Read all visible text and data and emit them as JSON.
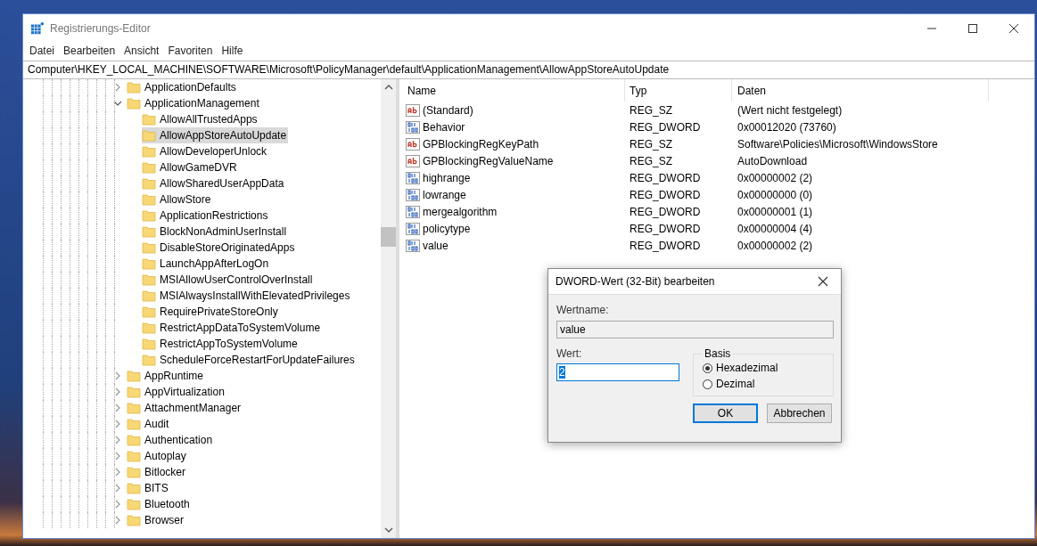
{
  "window": {
    "title": "Registrierungs-Editor"
  },
  "menu": [
    "Datei",
    "Bearbeiten",
    "Ansicht",
    "Favoriten",
    "Hilfe"
  ],
  "address": "Computer\\HKEY_LOCAL_MACHINE\\SOFTWARE\\Microsoft\\PolicyManager\\default\\ApplicationManagement\\AllowAppStoreAutoUpdate",
  "tree": {
    "items": [
      {
        "label": "ApplicationDefaults",
        "expanded": false,
        "selected": false
      },
      {
        "label": "ApplicationManagement",
        "expanded": true,
        "selected": false,
        "children": [
          {
            "label": "AllowAllTrustedApps",
            "selected": false
          },
          {
            "label": "AllowAppStoreAutoUpdate",
            "selected": true
          },
          {
            "label": "AllowDeveloperUnlock",
            "selected": false
          },
          {
            "label": "AllowGameDVR",
            "selected": false
          },
          {
            "label": "AllowSharedUserAppData",
            "selected": false
          },
          {
            "label": "AllowStore",
            "selected": false
          },
          {
            "label": "ApplicationRestrictions",
            "selected": false
          },
          {
            "label": "BlockNonAdminUserInstall",
            "selected": false
          },
          {
            "label": "DisableStoreOriginatedApps",
            "selected": false
          },
          {
            "label": "LaunchAppAfterLogOn",
            "selected": false
          },
          {
            "label": "MSIAllowUserControlOverInstall",
            "selected": false
          },
          {
            "label": "MSIAlwaysInstallWithElevatedPrivileges",
            "selected": false
          },
          {
            "label": "RequirePrivateStoreOnly",
            "selected": false
          },
          {
            "label": "RestrictAppDataToSystemVolume",
            "selected": false
          },
          {
            "label": "RestrictAppToSystemVolume",
            "selected": false
          },
          {
            "label": "ScheduleForceRestartForUpdateFailures",
            "selected": false
          }
        ]
      },
      {
        "label": "AppRuntime",
        "expanded": false,
        "selected": false
      },
      {
        "label": "AppVirtualization",
        "expanded": false,
        "selected": false
      },
      {
        "label": "AttachmentManager",
        "expanded": false,
        "selected": false
      },
      {
        "label": "Audit",
        "expanded": false,
        "selected": false
      },
      {
        "label": "Authentication",
        "expanded": false,
        "selected": false
      },
      {
        "label": "Autoplay",
        "expanded": false,
        "selected": false
      },
      {
        "label": "Bitlocker",
        "expanded": false,
        "selected": false
      },
      {
        "label": "BITS",
        "expanded": false,
        "selected": false
      },
      {
        "label": "Bluetooth",
        "expanded": false,
        "selected": false
      },
      {
        "label": "Browser",
        "expanded": false,
        "selected": false
      }
    ]
  },
  "values": {
    "columns": [
      "Name",
      "Typ",
      "Daten"
    ],
    "rows": [
      {
        "kind": "string",
        "name": "(Standard)",
        "type": "REG_SZ",
        "data": "(Wert nicht festgelegt)"
      },
      {
        "kind": "binary",
        "name": "Behavior",
        "type": "REG_DWORD",
        "data": "0x00012020 (73760)"
      },
      {
        "kind": "string",
        "name": "GPBlockingRegKeyPath",
        "type": "REG_SZ",
        "data": "Software\\Policies\\Microsoft\\WindowsStore"
      },
      {
        "kind": "string",
        "name": "GPBlockingRegValueName",
        "type": "REG_SZ",
        "data": "AutoDownload"
      },
      {
        "kind": "binary",
        "name": "highrange",
        "type": "REG_DWORD",
        "data": "0x00000002 (2)"
      },
      {
        "kind": "binary",
        "name": "lowrange",
        "type": "REG_DWORD",
        "data": "0x00000000 (0)"
      },
      {
        "kind": "binary",
        "name": "mergealgorithm",
        "type": "REG_DWORD",
        "data": "0x00000001 (1)"
      },
      {
        "kind": "binary",
        "name": "policytype",
        "type": "REG_DWORD",
        "data": "0x00000004 (4)"
      },
      {
        "kind": "binary",
        "name": "value",
        "type": "REG_DWORD",
        "data": "0x00000002 (2)"
      }
    ]
  },
  "dialog": {
    "title": "DWORD-Wert (32-Bit) bearbeiten",
    "name_label": "Wertname:",
    "name_value": "value",
    "value_label": "Wert:",
    "value": "2",
    "base_label": "Basis",
    "bases": [
      {
        "label": "Hexadezimal",
        "selected": true
      },
      {
        "label": "Dezimal",
        "selected": false
      }
    ],
    "buttons": [
      {
        "label": "OK",
        "default": true
      },
      {
        "label": "Abbrechen",
        "default": false
      }
    ]
  }
}
